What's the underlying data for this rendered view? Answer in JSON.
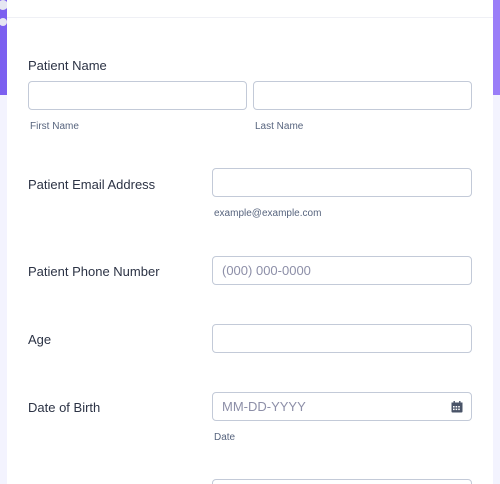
{
  "form": {
    "patient_name": {
      "label": "Patient Name",
      "first_label": "First Name",
      "last_label": "Last Name",
      "first_value": "",
      "last_value": ""
    },
    "email": {
      "label": "Patient Email Address",
      "value": "",
      "hint": "example@example.com"
    },
    "phone": {
      "label": "Patient Phone Number",
      "placeholder": "(000) 000-0000"
    },
    "age": {
      "label": "Age",
      "value": ""
    },
    "dob": {
      "label": "Date of Birth",
      "placeholder": "MM-DD-YYYY",
      "hint": "Date",
      "icon": "calendar-icon"
    }
  },
  "colors": {
    "accent": "#7b5ff0",
    "text": "#2c3345",
    "border": "#c3cad8",
    "muted": "#57647e"
  }
}
